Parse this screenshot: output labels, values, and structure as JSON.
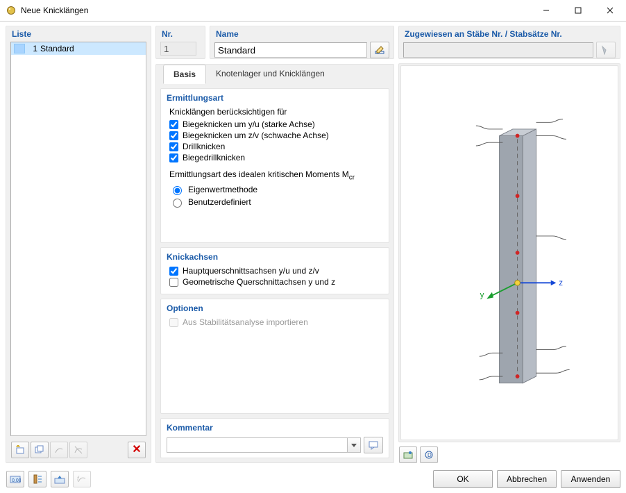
{
  "window": {
    "title": "Neue Knicklängen"
  },
  "liste": {
    "header": "Liste",
    "items": [
      {
        "num": "1",
        "name": "Standard"
      }
    ]
  },
  "nr": {
    "header": "Nr.",
    "value": "1"
  },
  "name": {
    "header": "Name",
    "value": "Standard"
  },
  "assigned": {
    "header": "Zugewiesen an Stäbe Nr. / Stabsätze Nr.",
    "value": ""
  },
  "tabs": {
    "basis": "Basis",
    "knoten": "Knotenlager und Knicklängen"
  },
  "ermittlung": {
    "header": "Ermittlungsart",
    "consider_label": "Knicklängen berücksichtigen für",
    "c1": "Biegeknicken um y/u (starke Achse)",
    "c2": "Biegeknicken um z/v (schwache Achse)",
    "c3": "Drillknicken",
    "c4": "Biegedrillknicken",
    "mcr_label": "Ermittlungsart des idealen kritischen Moments M",
    "mcr_sub": "cr",
    "r1": "Eigenwertmethode",
    "r2": "Benutzerdefiniert"
  },
  "knickachsen": {
    "header": "Knickachsen",
    "c1": "Hauptquerschnittsachsen y/u und z/v",
    "c2": "Geometrische Querschnittachsen y und z"
  },
  "optionen": {
    "header": "Optionen",
    "c1": "Aus Stabilitätsanalyse importieren"
  },
  "kommentar": {
    "header": "Kommentar",
    "value": ""
  },
  "preview": {
    "z": "z",
    "y": "y"
  },
  "buttons": {
    "ok": "OK",
    "cancel": "Abbrechen",
    "apply": "Anwenden"
  }
}
